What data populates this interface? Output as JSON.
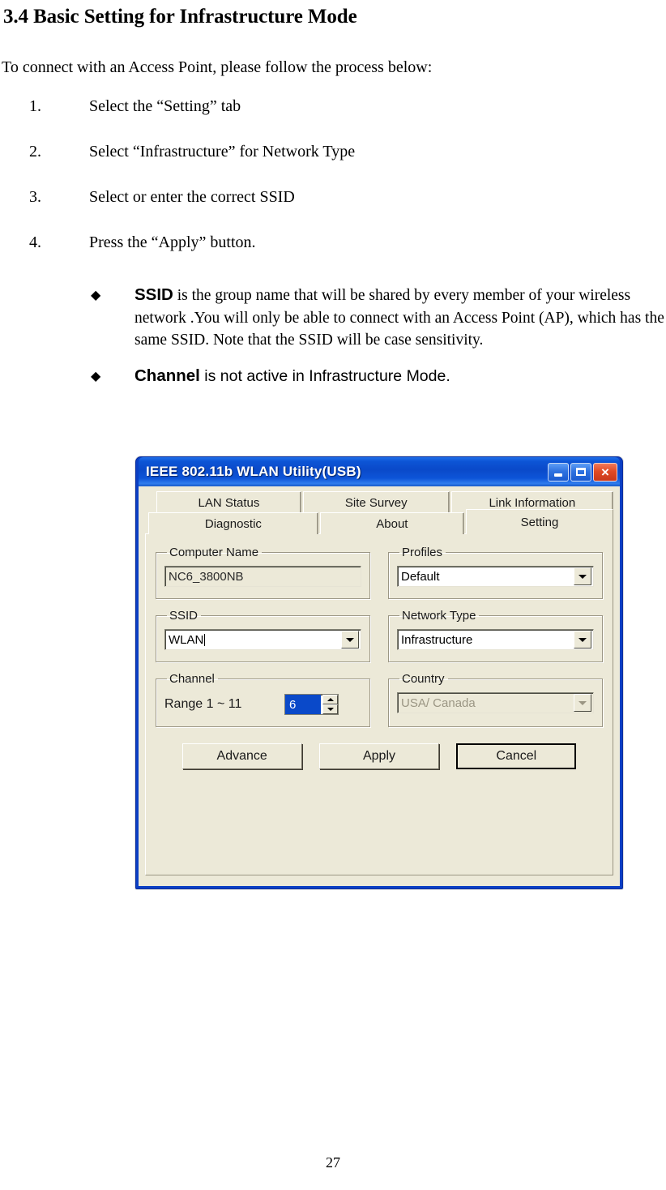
{
  "document": {
    "heading": "3.4 Basic Setting for Infrastructure Mode",
    "intro": "To connect with an Access Point, please follow the process below:",
    "steps": [
      {
        "num": "1.",
        "text": "Select the “Setting” tab"
      },
      {
        "num": "2.",
        "text": "Select “Infrastructure” for Network Type"
      },
      {
        "num": "3.",
        "text": "Select or enter the correct SSID"
      },
      {
        "num": "4.",
        "text": "Press the “Apply” button."
      }
    ],
    "bullets": [
      {
        "glyph": "◆",
        "keyword": "SSID",
        "rest": " is the group name that will be shared by every member of your wireless network .You will only be able to connect with an Access Point (AP), which has the same SSID. Note that the SSID will be case sensitivity."
      },
      {
        "glyph": "◆",
        "keyword": "Channel",
        "rest": " is not active in Infrastructure Mode."
      }
    ],
    "page_number": "27"
  },
  "dialog": {
    "title": "IEEE 802.11b WLAN Utility(USB)",
    "window_buttons": {
      "minimize": "minimize-icon",
      "maximize": "maximize-icon",
      "close": "×"
    },
    "tabs": {
      "row1": [
        "LAN Status",
        "Site Survey",
        "Link Information"
      ],
      "row2": [
        "Diagnostic",
        "About",
        "Setting"
      ],
      "active": "Setting"
    },
    "groups": {
      "computer_name": {
        "legend": "Computer Name",
        "value": "NC6_3800NB"
      },
      "profiles": {
        "legend": "Profiles",
        "value": "Default"
      },
      "ssid": {
        "legend": "SSID",
        "value": "WLAN"
      },
      "network_type": {
        "legend": "Network Type",
        "value": "Infrastructure"
      },
      "channel": {
        "legend": "Channel",
        "range_label": "Range 1 ~ 11",
        "value": "6"
      },
      "country": {
        "legend": "Country",
        "value": "USA/ Canada",
        "disabled": true
      }
    },
    "buttons": {
      "advance": "Advance",
      "apply": "Apply",
      "cancel": "Cancel"
    },
    "colors": {
      "titlebar_blue": "#0a49c9",
      "dialog_face": "#ece9d8",
      "selection_blue": "#0a49c9",
      "close_red": "#e04a24"
    }
  }
}
